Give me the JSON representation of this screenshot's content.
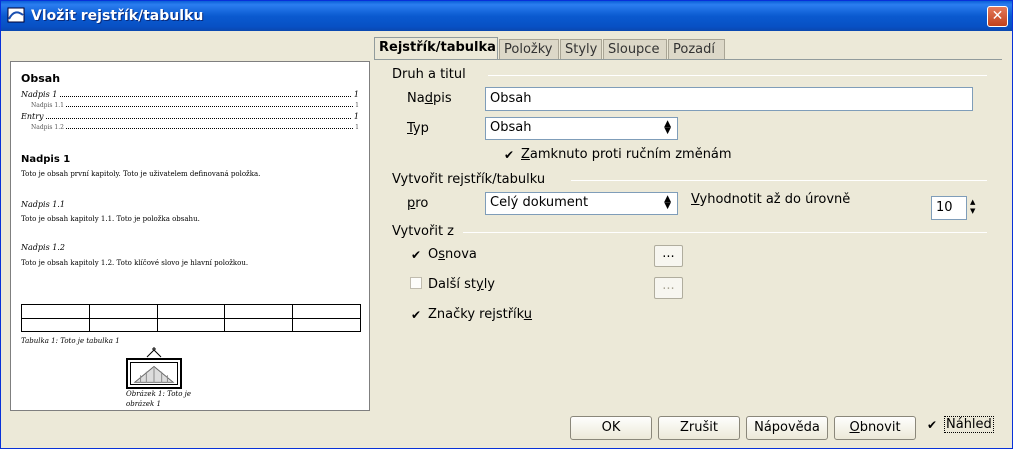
{
  "window": {
    "title": "Vložit rejstřík/tabulku",
    "close_symbol": "✕"
  },
  "preview": {
    "toc_title": "Obsah",
    "toc": [
      {
        "text": "Nadpis 1",
        "page": "1",
        "level": 1
      },
      {
        "text": "Nadpis 1.1",
        "page": "1",
        "level": 2
      },
      {
        "text": "Entry",
        "page": "1",
        "level": 1
      },
      {
        "text": "Nadpis 1.2",
        "page": "1",
        "level": 2
      }
    ],
    "heading1": "Nadpis 1",
    "text1": "Toto je obsah první kapitoly. Toto je uživatelem definovaná položka.",
    "heading11": "Nadpis 1.1",
    "text11": "Toto je obsah kapitoly 1.1. Toto je položka obsahu.",
    "heading12": "Nadpis 1.2",
    "text12": "Toto je obsah kapitoly 1.2. Toto klíčové slovo je hlavní položkou.",
    "table_caption": "Tabulka 1: Toto je tabulka 1",
    "figure_caption": "Obrázek 1: Toto je obrázek 1"
  },
  "tabs": [
    "Rejstřík/tabulka",
    "Položky",
    "Styly",
    "Sloupce",
    "Pozadí"
  ],
  "active_tab": "Rejstřík/tabulka",
  "type_title": {
    "section": "Druh a titul",
    "title_label_pre": "Na",
    "title_label_u": "d",
    "title_label_post": "pis",
    "title_value": "Obsah",
    "type_label_u": "T",
    "type_label_post": "yp",
    "type_value": "Obsah",
    "protect_pre": "",
    "protect_u": "Z",
    "protect_post": "amknuto proti ručním změnám",
    "protect_checked": true
  },
  "create_index": {
    "section": "Vytvořit rejstřík/tabulku",
    "for_label_u": "p",
    "for_label_post": "ro",
    "for_value": "Celý dokument",
    "eval_u": "V",
    "eval_post": "yhodnotit až do úrovně",
    "level_value": "10"
  },
  "create_from": {
    "section": "Vytvořit z",
    "outline_pre": "O",
    "outline_u": "s",
    "outline_post": "nova",
    "outline_checked": true,
    "styles_pre": "Další st",
    "styles_u": "y",
    "styles_post": "ly",
    "styles_checked": false,
    "marks_pre": "Značky rejstřík",
    "marks_u": "u",
    "marks_post": "",
    "marks_checked": true,
    "browse_label": "..."
  },
  "buttons": {
    "ok": "OK",
    "cancel": "Zrušit",
    "help": "Nápověda",
    "reset_u": "O",
    "reset_post": "bnovit",
    "preview_label": "Náhled",
    "preview_checked": true
  },
  "colors": {
    "titlebar": "#0a5ad0",
    "face": "#ece9d8",
    "field_border": "#7f9db9"
  }
}
